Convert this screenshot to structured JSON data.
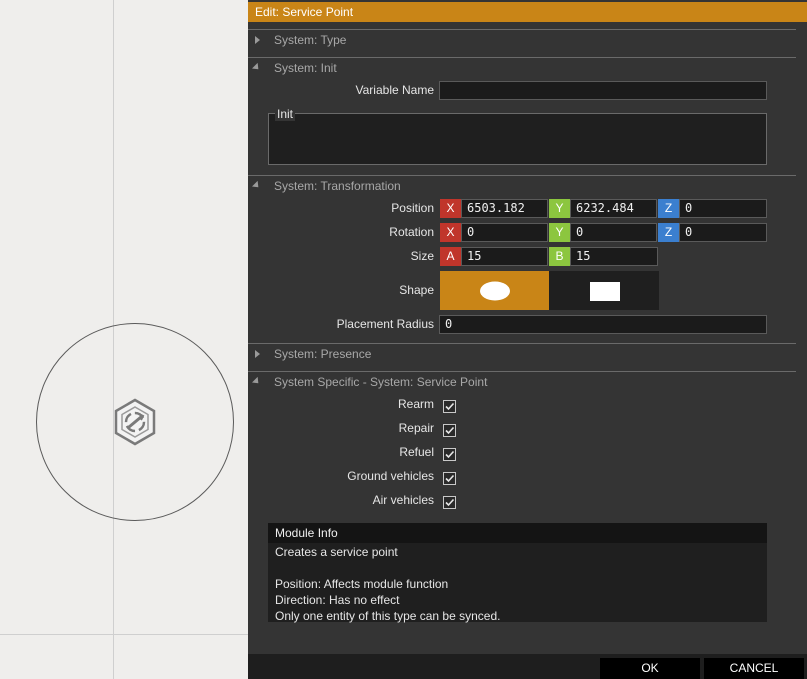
{
  "dialog": {
    "title": "Edit: Service Point"
  },
  "sections": {
    "type": "System: Type",
    "init": "System: Init",
    "transformation": "System: Transformation",
    "presence": "System: Presence",
    "specific": "System Specific - System: Service Point"
  },
  "init": {
    "variable_name_label": "Variable Name",
    "variable_name_value": "",
    "init_label": "Init",
    "init_value": ""
  },
  "transformation": {
    "position_label": "Position",
    "rotation_label": "Rotation",
    "size_label": "Size",
    "shape_label": "Shape",
    "placement_radius_label": "Placement Radius",
    "axis_x": "X",
    "axis_y": "Y",
    "axis_z": "Z",
    "axis_a": "A",
    "axis_b": "B",
    "position": {
      "x": "6503.182",
      "y": "6232.484",
      "z": "0"
    },
    "rotation": {
      "x": "0",
      "y": "0",
      "z": "0"
    },
    "size": {
      "a": "15",
      "b": "15"
    },
    "shape_options": [
      "ellipse",
      "rectangle"
    ],
    "shape_selected": "ellipse",
    "placement_radius": "0"
  },
  "service_point": {
    "options": [
      {
        "label": "Rearm",
        "checked": true
      },
      {
        "label": "Repair",
        "checked": true
      },
      {
        "label": "Refuel",
        "checked": true
      },
      {
        "label": "Ground vehicles",
        "checked": true
      },
      {
        "label": "Air vehicles",
        "checked": true
      }
    ]
  },
  "module_info": {
    "title": "Module Info",
    "lines": [
      "Creates a service point",
      "",
      "Position: Affects module function",
      "Direction: Has no effect",
      "Only one entity of this type can be synced."
    ]
  },
  "buttons": {
    "ok": "OK",
    "cancel": "CANCEL"
  },
  "colors": {
    "accent": "#c98517",
    "axis_x": "#c0352b",
    "axis_y": "#8cc63f",
    "axis_z": "#3b7fcf"
  },
  "icons": {
    "map_marker": "service-point-icon"
  }
}
